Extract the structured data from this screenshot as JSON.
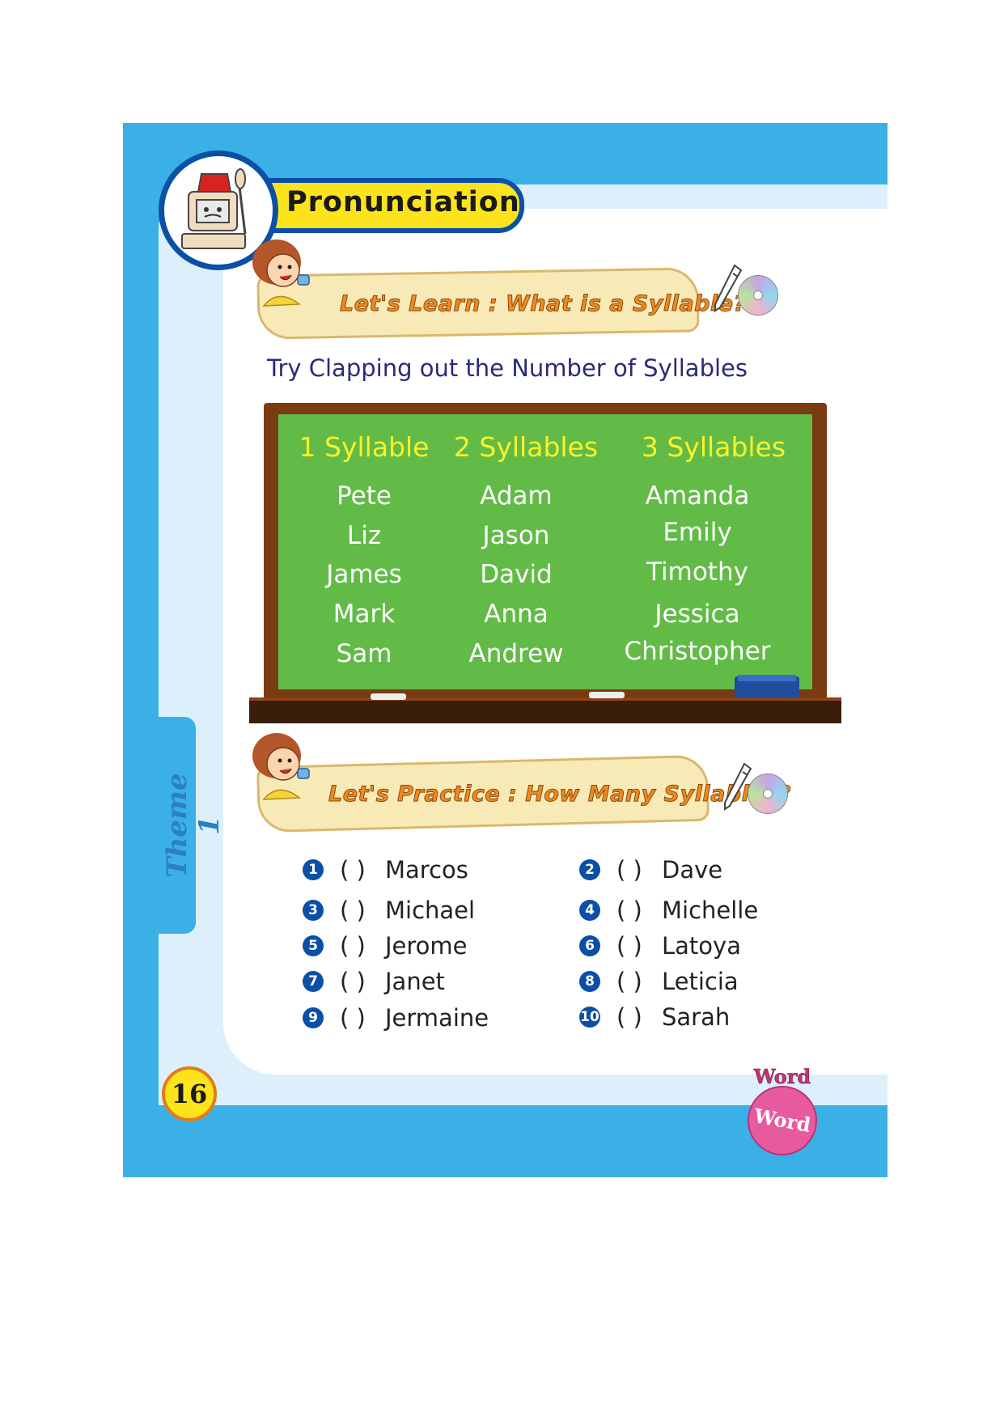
{
  "theme_label": "Theme 1",
  "title": "Pronunciation",
  "learn_banner": "Let's Learn : What is a Syllable?",
  "subtitle": "Try Clapping out the Number of Syllables",
  "chalkboard": {
    "columns": [
      {
        "heading": "1 Syllable",
        "names": [
          "Pete",
          "Liz",
          "James",
          "Mark",
          "Sam"
        ]
      },
      {
        "heading": "2 Syllables",
        "names": [
          "Adam",
          "Jason",
          "David",
          "Anna",
          "Andrew"
        ]
      },
      {
        "heading": "3 Syllables",
        "names": [
          "Amanda",
          "Emily",
          "Timothy",
          "Jessica",
          "Christopher"
        ]
      }
    ]
  },
  "practice_banner": "Let's Practice : How Many Syllables?",
  "practice_items": [
    {
      "number": "1",
      "paren": "(   )",
      "name": "Marcos"
    },
    {
      "number": "2",
      "paren": "(   )",
      "name": "Dave"
    },
    {
      "number": "3",
      "paren": "(   )",
      "name": "Michael"
    },
    {
      "number": "4",
      "paren": "(   )",
      "name": "Michelle"
    },
    {
      "number": "5",
      "paren": "(   )",
      "name": "Jerome"
    },
    {
      "number": "6",
      "paren": "(   )",
      "name": "Latoya"
    },
    {
      "number": "7",
      "paren": "(   )",
      "name": "Janet"
    },
    {
      "number": "8",
      "paren": "(   )",
      "name": "Leticia"
    },
    {
      "number": "9",
      "paren": "(   )",
      "name": "Jermaine"
    },
    {
      "number": "10",
      "paren": "(   )",
      "name": "Sarah"
    }
  ],
  "page_number": "16",
  "badge": {
    "top": "Word",
    "bottom": "Word"
  },
  "colors": {
    "frame": "#3ab0e6",
    "title_pill": "#fde31c",
    "chalkboard": "#62bb47",
    "chalk_heading": "#fbf22a",
    "number_circle": "#0b4fa6"
  }
}
